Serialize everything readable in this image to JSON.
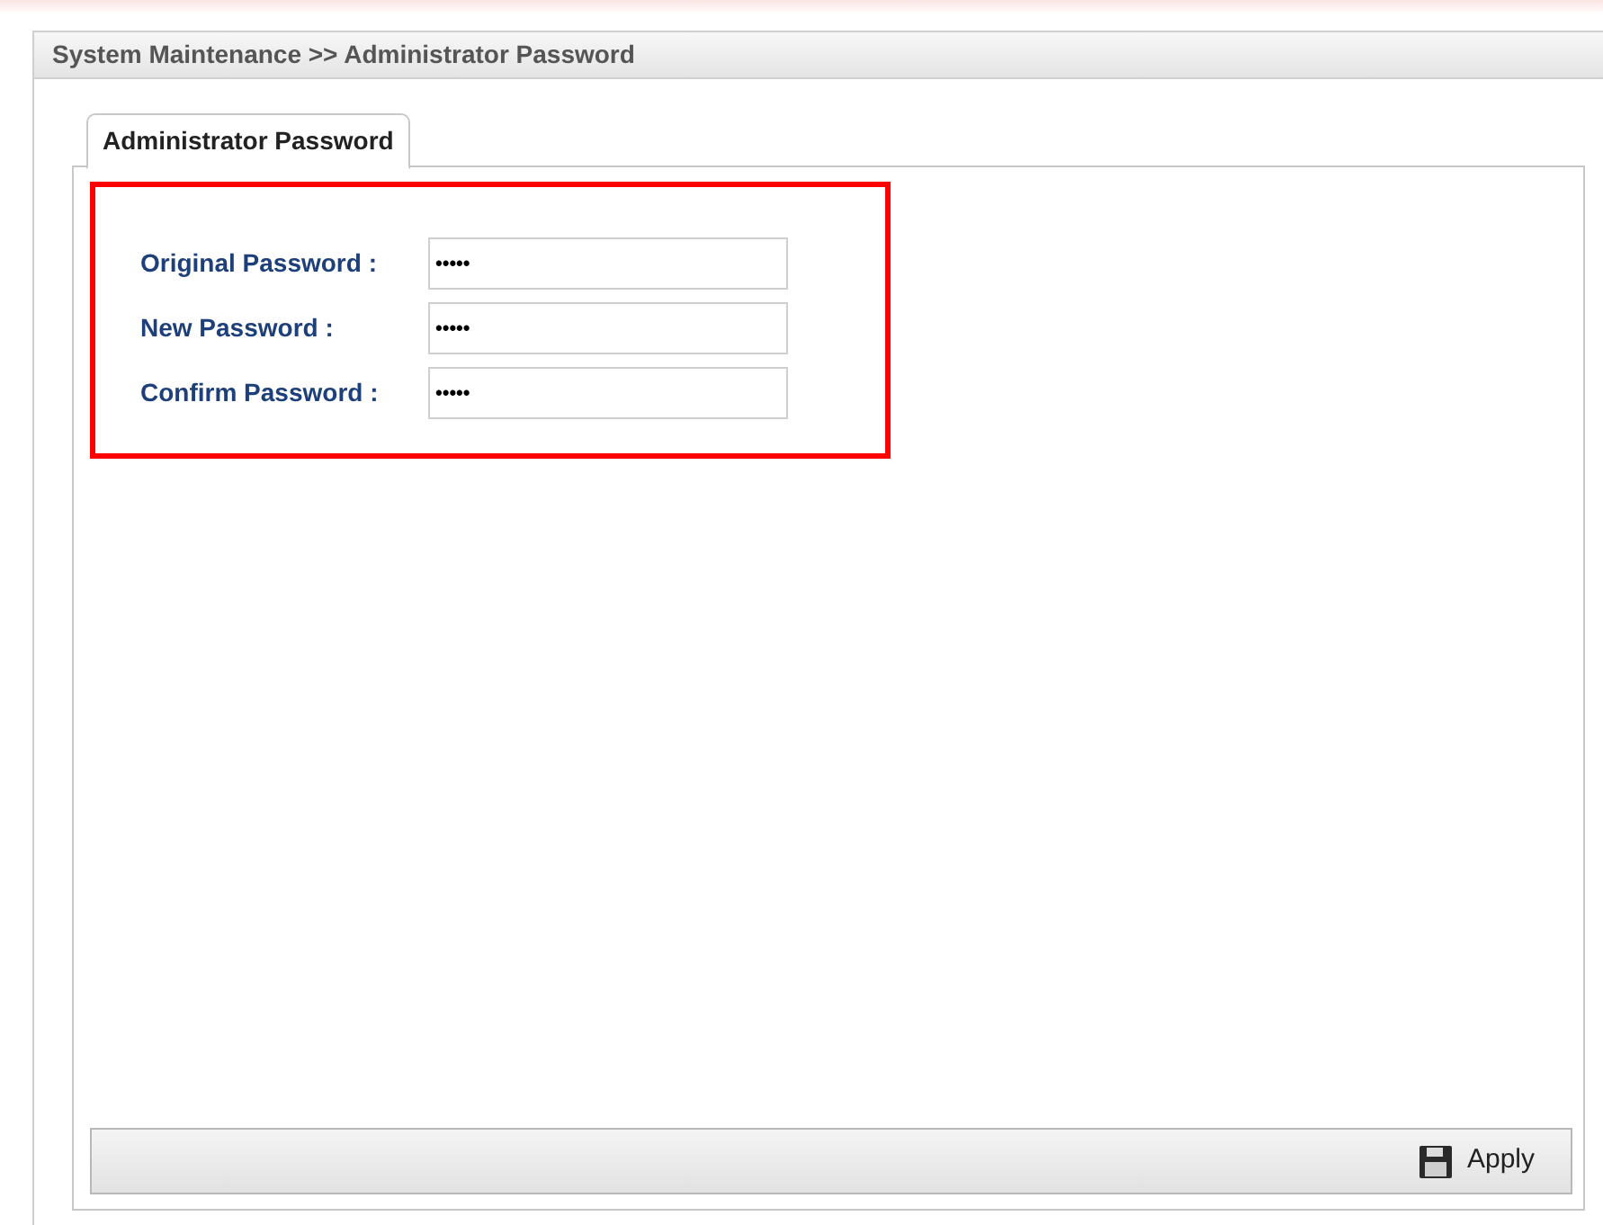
{
  "header": {
    "title": "System Maintenance >> Administrator Password"
  },
  "tabs": [
    {
      "label": "Administrator Password",
      "selected": true
    }
  ],
  "form": {
    "highlighted": true,
    "fields": [
      {
        "label": "Original Password :",
        "value": "•••••"
      },
      {
        "label": "New Password :",
        "value": "•••••"
      },
      {
        "label": "Confirm Password :",
        "value": "•••••"
      }
    ]
  },
  "buttons": [
    {
      "label": "Apply"
    }
  ]
}
